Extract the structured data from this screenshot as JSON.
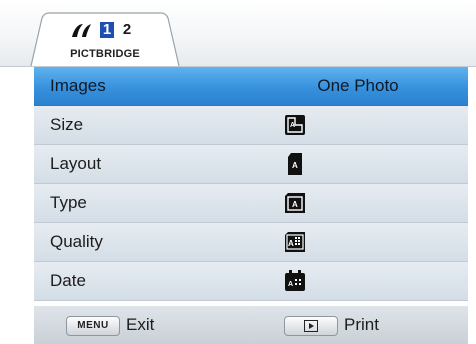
{
  "header": {
    "tab_icons": [
      "camera-icon",
      "page-1-icon",
      "page-2-icon"
    ],
    "page_numbers": [
      "1",
      "2"
    ],
    "active_page": "1",
    "tab_label": "PICTBRIDGE"
  },
  "menu": {
    "rows": [
      {
        "label": "Images",
        "value": "One Photo",
        "selected": true
      },
      {
        "label": "Size",
        "icon": "size-icon"
      },
      {
        "label": "Layout",
        "icon": "layout-icon"
      },
      {
        "label": "Type",
        "icon": "type-icon"
      },
      {
        "label": "Quality",
        "icon": "quality-icon"
      },
      {
        "label": "Date",
        "icon": "date-icon"
      }
    ]
  },
  "footer": {
    "menu_key": "MENU",
    "exit_label": "Exit",
    "play_key_icon": "play-icon",
    "print_label": "Print"
  },
  "colors": {
    "selected_row": "#3791dc",
    "row_bg": "#dde4eb",
    "active_page_bg": "#1e4fb0"
  }
}
